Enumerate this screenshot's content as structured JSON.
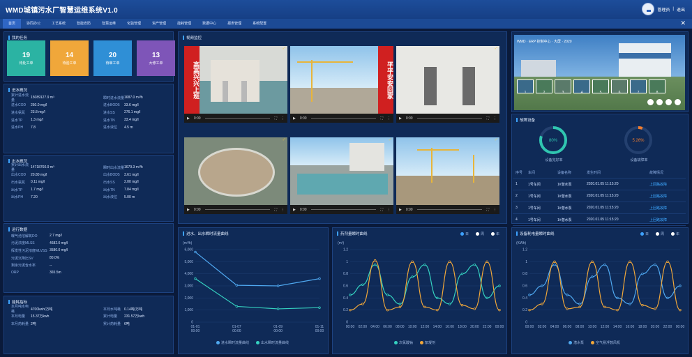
{
  "app": {
    "title": "WMD城镇污水厂智慧运维系统V1.0",
    "user": "管理员",
    "logout": "退出"
  },
  "nav": [
    "首页",
    "协同办公",
    "工艺系统",
    "智能安防",
    "智慧运维",
    "化验管理",
    "资产管理",
    "能耗管理",
    "数据中心",
    "报表管理",
    "系统配置"
  ],
  "tasks": {
    "title": "我的任务",
    "tiles": [
      {
        "num": "19",
        "label": "待处工单",
        "color": "#2bb3a3"
      },
      {
        "num": "14",
        "label": "待验工单",
        "color": "#f0a73a"
      },
      {
        "num": "20",
        "label": "待审工单",
        "color": "#2f8fd6"
      },
      {
        "num": "13",
        "label": "大修工单",
        "color": "#7e55b8"
      }
    ]
  },
  "influent": {
    "title": "进水概况",
    "rows": [
      {
        "k": "累计进水流量",
        "v": "15089127.9 m³",
        "k2": "瞬时进水流量",
        "v2": "1687.0 m³/h"
      },
      {
        "k": "进水COD",
        "v": "250.0 mg/l",
        "k2": "进水BOD5",
        "v2": "33.6 mg/l"
      },
      {
        "k": "进水氨氮",
        "v": "23.8 mg/l",
        "k2": "进水SS",
        "v2": "276.1 mg/l"
      },
      {
        "k": "进水TP",
        "v": "1.3 mg/l",
        "k2": "进水TN",
        "v2": "33.4 mg/l"
      },
      {
        "k": "进水PH",
        "v": "7.8",
        "k2": "进水液位",
        "v2": "4.5 m"
      }
    ]
  },
  "effluent": {
    "title": "出水概况",
    "rows": [
      {
        "k": "累计出水流量",
        "v": "14718760.9 m³",
        "k2": "瞬时出水流量",
        "v2": "1679.3 m³/h"
      },
      {
        "k": "出水COD",
        "v": "20.80 mg/l",
        "k2": "出水BOD5",
        "v2": "3.61 mg/l"
      },
      {
        "k": "出水氨氮",
        "v": "0.11 mg/l",
        "k2": "出水SS",
        "v2": "2.00 mg/l"
      },
      {
        "k": "出水TP",
        "v": "1.7 mg/l",
        "k2": "出水TN",
        "v2": "7.84 mg/l"
      },
      {
        "k": "出水PH",
        "v": "7.20",
        "k2": "出水液位",
        "v2": "5.00 m"
      }
    ]
  },
  "operation": {
    "title": "运行数据",
    "rows": [
      {
        "k": "曝气池溶解氧DO",
        "v": "2.7 mg/l"
      },
      {
        "k": "污泥浓度MLSS",
        "v": "4682.0 mg/l"
      },
      {
        "k": "挥发性污泥浓度MLVSS",
        "v": "3580.0 mg/l"
      },
      {
        "k": "污泥沉降比SV",
        "v": "80.0%"
      },
      {
        "k": "剩余污泥含水率",
        "v": "--"
      },
      {
        "k": "ORP",
        "v": "365.5m"
      }
    ]
  },
  "energy": {
    "title": "能耗指标",
    "rows": [
      {
        "k": "本月吨水电耗",
        "v": "4700kwh/万吨",
        "k2": "本月水吨耗",
        "v2": "0.14吨/万吨"
      },
      {
        "k": "本月电量",
        "v": "15.37万kwh",
        "k2": "累计电量",
        "v2": "231.57万kwh"
      },
      {
        "k": "本月药耗量",
        "v": "2吨",
        "k2": "累计药耗量",
        "v2": "6吨"
      }
    ]
  },
  "video": {
    "title": "视频监控",
    "time": "0:00",
    "sign_left": "高高兴兴上班",
    "sign_right": "平平安安回家"
  },
  "factory": {
    "overlay": "WMD · ERP 控制中心 · 大屏 · 2020",
    "thumbs": [
      "1",
      "2",
      "3",
      "4",
      "5",
      "6",
      "7",
      "8"
    ]
  },
  "faults": {
    "title": "故障设备",
    "donuts": [
      {
        "value": "80%",
        "label": "设备完好率",
        "color": "#30c6b0",
        "fraction": 0.8
      },
      {
        "value": "5.26%",
        "label": "设备故障率",
        "color": "#f07c2e",
        "fraction": 0.0526
      }
    ],
    "headers": [
      "序号",
      "车间",
      "设备名称",
      "发生时间",
      "故障情况"
    ],
    "rows": [
      [
        "1",
        "1号车间",
        "1#潜水泵",
        "2020.01.05 11:15:20",
        "上回路故障"
      ],
      [
        "2",
        "1号车间",
        "1#潜水泵",
        "2020.01.05 11:15:20",
        "上回路故障"
      ],
      [
        "3",
        "1号车间",
        "1#潜水泵",
        "2020.01.05 11:15:20",
        "上回路故障"
      ],
      [
        "4",
        "1号车间",
        "1#潜水泵",
        "2020.01.05 11:15:20",
        "上回路故障"
      ]
    ]
  },
  "flow_chart": {
    "title": "进水、出水瞬时流量曲线",
    "unit": "(m³/h)",
    "legend": [
      "进水瞬时流量曲线",
      "出水瞬时流量曲线"
    ]
  },
  "dose_chart": {
    "title": "药剂量瞬时曲线",
    "unit": "(m³)",
    "legend": [
      "次氯酸钠",
      "絮凝剂"
    ],
    "toggles": [
      "日",
      "周",
      "年"
    ]
  },
  "power_chart": {
    "title": "设备耗电量瞬时曲线",
    "unit": "(KWh)",
    "legend": [
      "潜水泵",
      "空气悬浮鼓风机"
    ],
    "toggles": [
      "日",
      "周",
      "年"
    ]
  },
  "chart_data": [
    {
      "type": "line",
      "title": "进水、出水瞬时流量曲线",
      "ylabel": "(m³/h)",
      "x": [
        "01-01 00:00",
        "01-07 00:00",
        "01-09 00:00",
        "01-11 00:00"
      ],
      "ylim": [
        0,
        6000
      ],
      "yticks": [
        0,
        1000,
        2000,
        3000,
        4000,
        5000,
        6000
      ],
      "series": [
        {
          "name": "进水瞬时流量曲线",
          "color": "#4fa8f0",
          "values": [
            5800,
            3050,
            3000,
            3600
          ]
        },
        {
          "name": "出水瞬时流量曲线",
          "color": "#35d1c0",
          "values": [
            3600,
            1300,
            1100,
            1200
          ]
        }
      ]
    },
    {
      "type": "line",
      "title": "药剂量瞬时曲线",
      "ylabel": "(m³)",
      "x": [
        "00:00",
        "02:00",
        "04:00",
        "06:00",
        "08:00",
        "10:00",
        "12:00",
        "14:00",
        "16:00",
        "18:00",
        "20:00",
        "22:00",
        "00:00"
      ],
      "ylim": [
        0,
        1.2
      ],
      "yticks": [
        0,
        0.2,
        0.4,
        0.6,
        0.8,
        1,
        1.2
      ],
      "series": [
        {
          "name": "次氯酸钠",
          "color": "#35d1c0",
          "values": [
            0.45,
            0.62,
            0.95,
            0.45,
            0.3,
            0.75,
            0.95,
            0.4,
            0.3,
            0.8,
            0.95,
            0.4,
            0.6
          ]
        },
        {
          "name": "絮凝剂",
          "color": "#f0a73a",
          "values": [
            0.2,
            0.3,
            1.02,
            0.2,
            0.25,
            1.0,
            0.25,
            0.2,
            1.0,
            0.28,
            0.22,
            1.0,
            0.2
          ]
        }
      ]
    },
    {
      "type": "line",
      "title": "设备耗电量瞬时曲线",
      "ylabel": "(KWh)",
      "x": [
        "00:00",
        "02:00",
        "04:00",
        "06:00",
        "08:00",
        "10:00",
        "12:00",
        "14:00",
        "16:00",
        "18:00",
        "20:00",
        "22:00",
        "00:00"
      ],
      "ylim": [
        0,
        1.2
      ],
      "yticks": [
        0,
        0.2,
        0.4,
        0.6,
        0.8,
        1,
        1.2
      ],
      "series": [
        {
          "name": "潜水泵",
          "color": "#4fa8f0",
          "values": [
            0.45,
            0.6,
            0.95,
            0.45,
            0.3,
            0.75,
            0.95,
            0.4,
            0.3,
            0.8,
            0.95,
            0.4,
            0.6
          ]
        },
        {
          "name": "空气悬浮鼓风机",
          "color": "#f0a73a",
          "values": [
            0.2,
            0.3,
            1.0,
            0.22,
            0.25,
            1.0,
            0.25,
            0.2,
            1.0,
            0.28,
            0.22,
            1.0,
            0.2
          ]
        }
      ]
    }
  ]
}
